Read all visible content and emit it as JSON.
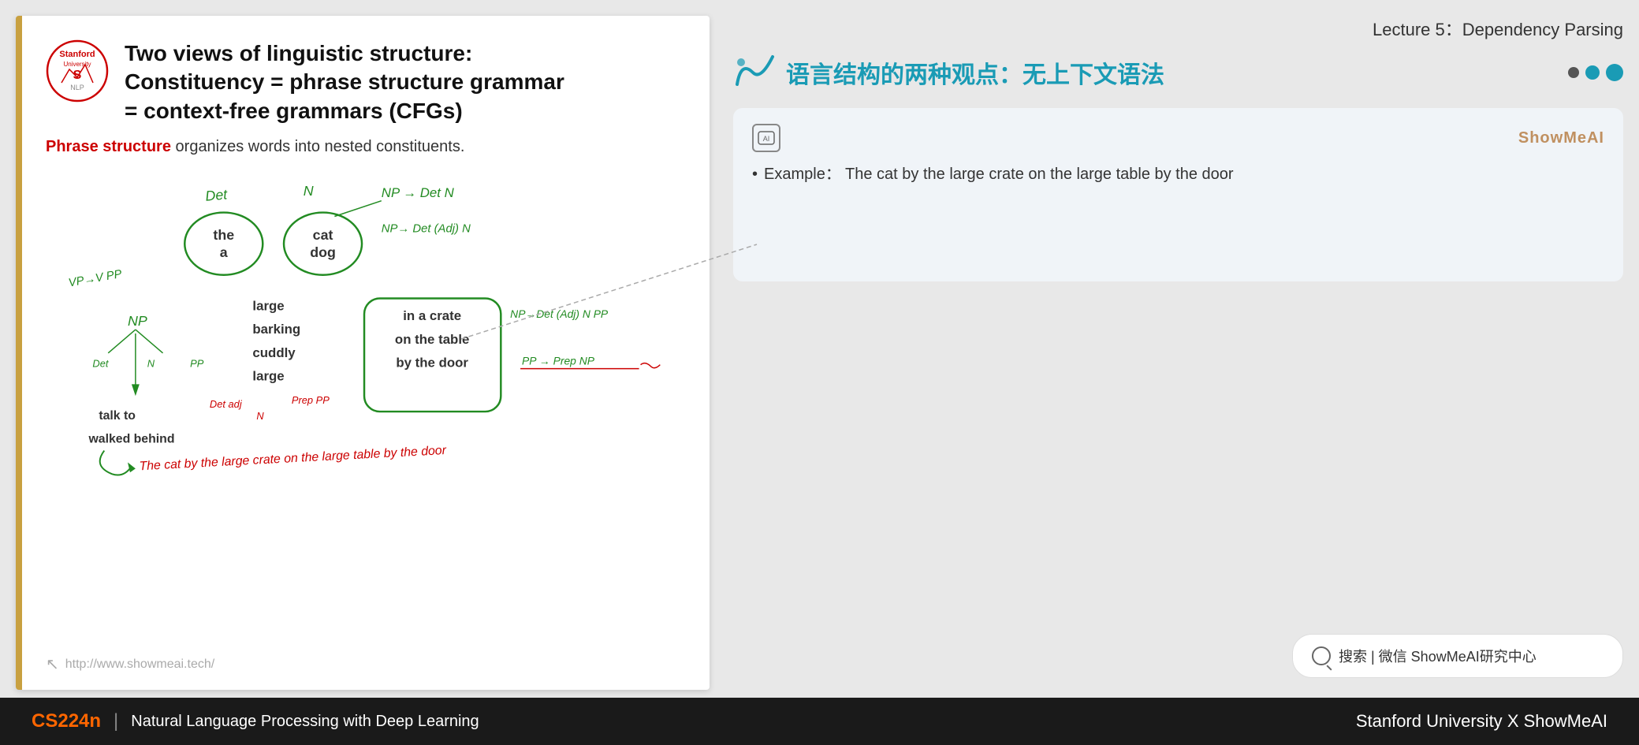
{
  "lecture": {
    "title": "Lecture 5：Dependency Parsing"
  },
  "slide": {
    "title_line1": "Two views of linguistic structure:",
    "title_line2": "Constituency = phrase structure grammar",
    "title_line3": "= context-free grammars (CFGs)",
    "phrase_structure_intro": "Phrase structure",
    "phrase_structure_rest": " organizes words into nested constituents.",
    "url": "http://www.showmeai.tech/"
  },
  "chinese_title": {
    "text": "语言结构的两种观点：无上下文语法"
  },
  "info_card": {
    "brand": "ShowMeAI",
    "example_label": "Example：",
    "example_text": "The cat by the large crate on the large table by the door"
  },
  "search_bar": {
    "text": "搜索 | 微信 ShowMeAI研究中心"
  },
  "bottom_bar": {
    "cs224n": "CS224n",
    "separator": "|",
    "course": "Natural Language Processing with Deep Learning",
    "university": "Stanford University",
    "x": "X",
    "brand": "ShowMeAI"
  },
  "dots": [
    {
      "color": "#555555",
      "size": 14
    },
    {
      "color": "#1a9bb5",
      "size": 18
    },
    {
      "color": "#1a9bb5",
      "size": 22
    }
  ],
  "tree": {
    "words": [
      "the/a",
      "cat/dog",
      "large/barking/cuddly/large",
      "in a crate",
      "on the table",
      "by the door"
    ],
    "labels": [
      "Det",
      "N",
      "NP",
      "VP→V PP",
      "NP",
      "Det N",
      "NP→Det(Adj)N",
      "NP→Det(Adj)N PP",
      "PP→Prep NP"
    ]
  },
  "footer_icon": "↖"
}
